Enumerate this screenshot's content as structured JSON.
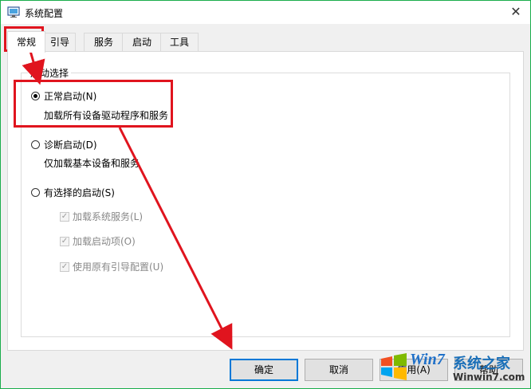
{
  "window": {
    "title": "系统配置",
    "close_glyph": "✕"
  },
  "tabs": [
    {
      "label": "常规",
      "active": true
    },
    {
      "label": "引导",
      "active": false
    },
    {
      "label": "服务",
      "active": false
    },
    {
      "label": "启动",
      "active": false
    },
    {
      "label": "工具",
      "active": false
    }
  ],
  "startup": {
    "group_label": "启动选择",
    "normal": {
      "label": "正常启动(N)",
      "desc": "加载所有设备驱动程序和服务",
      "checked": true
    },
    "diagnostic": {
      "label": "诊断启动(D)",
      "desc": "仅加载基本设备和服务",
      "checked": false
    },
    "selective": {
      "label": "有选择的启动(S)",
      "checked": false,
      "options": [
        {
          "label": "加载系统服务(L)",
          "checked": true
        },
        {
          "label": "加载启动项(O)",
          "checked": true
        },
        {
          "label": "使用原有引导配置(U)",
          "checked": true
        }
      ]
    }
  },
  "buttons": {
    "ok": "确定",
    "cancel": "取消",
    "apply": "应用(A)",
    "help": "帮助"
  },
  "watermark": {
    "text": "系统之家",
    "url": "Winwin7.com"
  },
  "colors": {
    "annotation": "#e0141e",
    "focus": "#0078d7",
    "title_border": "#1aad4b"
  }
}
